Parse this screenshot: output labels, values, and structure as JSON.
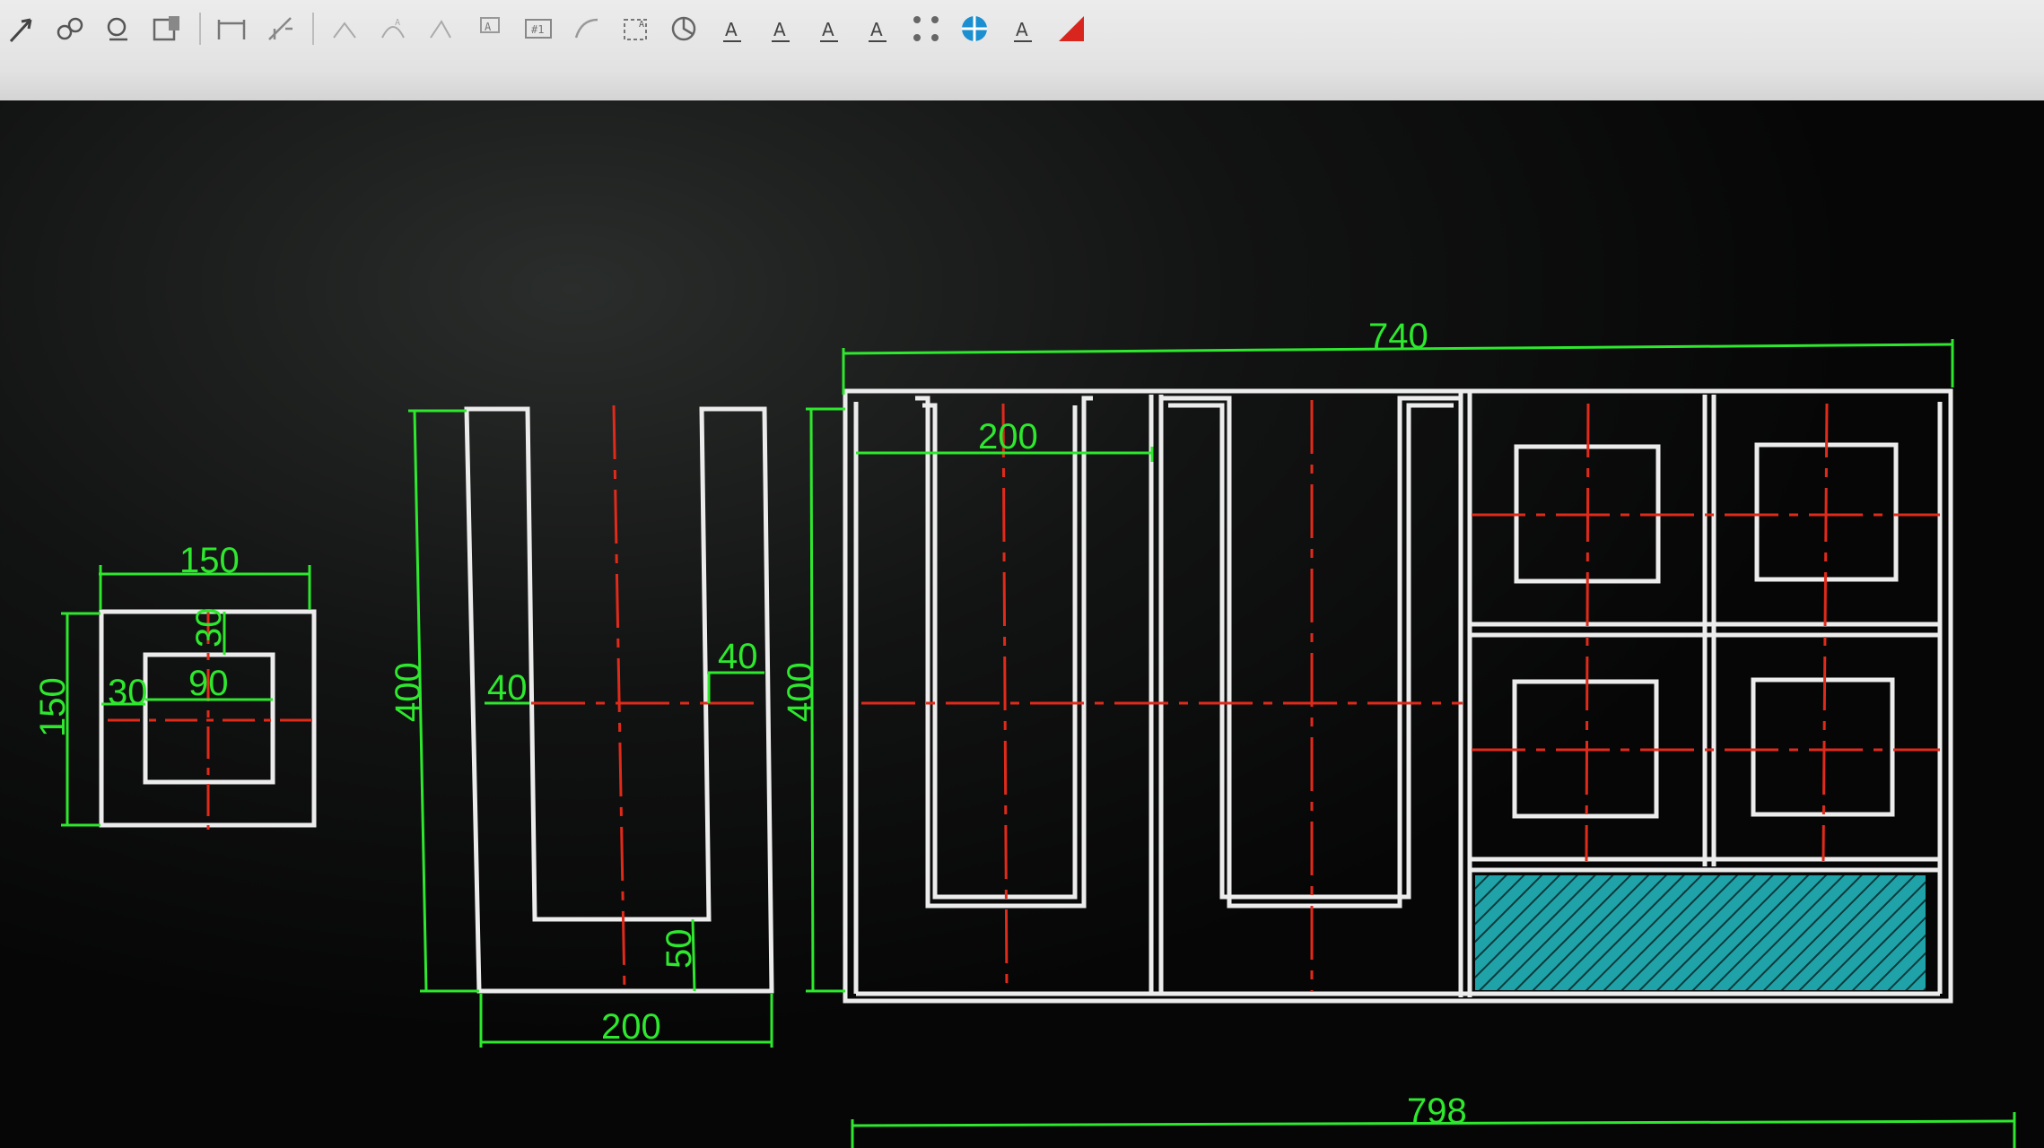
{
  "toolbar": {
    "items": [
      {
        "name": "arrow-tool-icon"
      },
      {
        "name": "block-tool-icon"
      },
      {
        "name": "search-tool-icon"
      },
      {
        "name": "table-tool-icon"
      },
      {
        "sep": true
      },
      {
        "name": "dim-linear-icon"
      },
      {
        "name": "dim-aligned-icon"
      },
      {
        "sep": true
      },
      {
        "name": "dim-continue-icon"
      },
      {
        "name": "dim-arc-icon"
      },
      {
        "name": "dim-angle-icon"
      },
      {
        "name": "text-insert-icon"
      },
      {
        "name": "field-icon"
      },
      {
        "name": "arc-length-icon"
      },
      {
        "name": "scale-area-icon"
      },
      {
        "name": "rotate-icon"
      },
      {
        "name": "text-align-icon",
        "label": "A"
      },
      {
        "name": "text-style-icon",
        "label": "A"
      },
      {
        "name": "multiline-text-icon",
        "label": "A"
      },
      {
        "name": "leader-text-icon",
        "label": "A"
      },
      {
        "name": "grip-icon"
      },
      {
        "name": "blue-circle-icon"
      },
      {
        "name": "curve-text-icon",
        "label": "A"
      },
      {
        "name": "red-triangle-icon"
      }
    ]
  },
  "colors": {
    "dimension": "#2ee82e",
    "outline": "#ececec",
    "centerline": "#e02a1a",
    "hatch": "#1fa3a8",
    "toolbar_bg": "#e4e4e4"
  },
  "dimensions": {
    "square_width": "150",
    "square_height": "150",
    "square_wall_top": "30",
    "square_wall_left": "30",
    "square_inner": "90",
    "u_height": "400",
    "u_left_wall": "40",
    "u_right_wall": "40",
    "u_bottom_wall": "50",
    "u_width": "200",
    "assembly_height": "400",
    "assembly_channel": "200",
    "assembly_width": "740",
    "overall_width": "798"
  }
}
